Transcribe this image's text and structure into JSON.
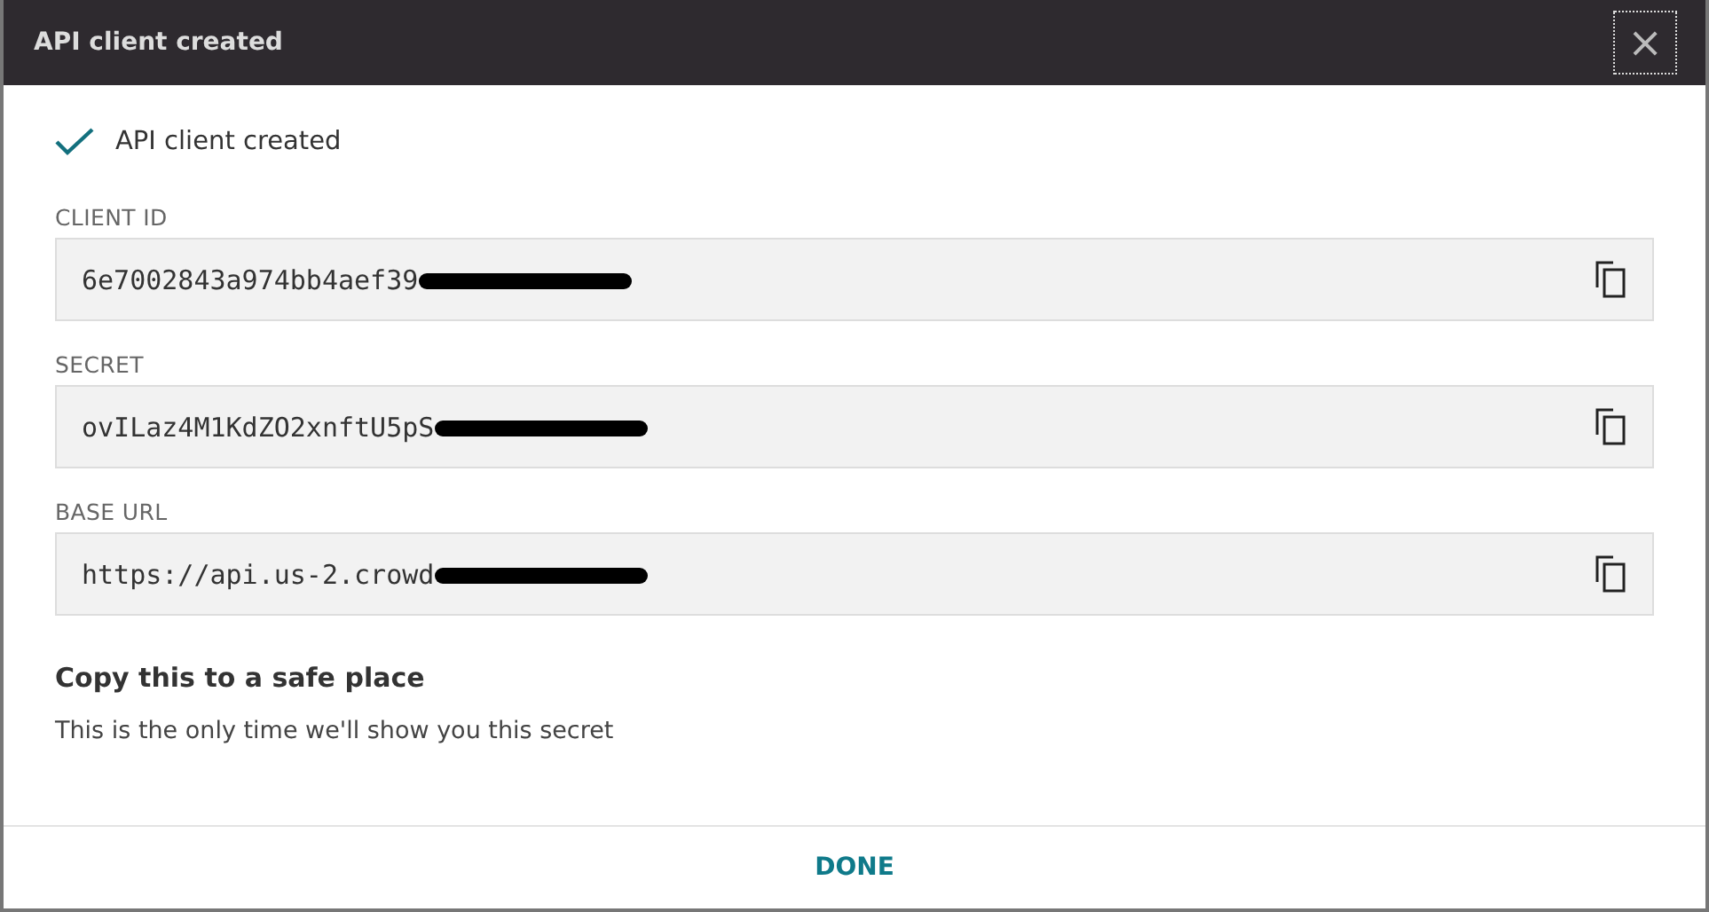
{
  "window": {
    "title": "API client created",
    "close": "×"
  },
  "status": {
    "done": true,
    "text": "API client created"
  },
  "fields": [
    {
      "label": "CLIENT ID",
      "value": "6e7002843a974bb4aef39",
      "redacted": true
    },
    {
      "label": "SECRET",
      "value": "ovILaz4M1KdZO2xnftU5pS",
      "redacted": true
    },
    {
      "label": "BASE URL",
      "value": "https://api.us-2.crowd",
      "redacted": true
    }
  ],
  "notice": {
    "title": "Copy this to a safe place",
    "text": "This is the only time we'll show you this secret"
  },
  "footer": {
    "button": "DONE"
  }
}
